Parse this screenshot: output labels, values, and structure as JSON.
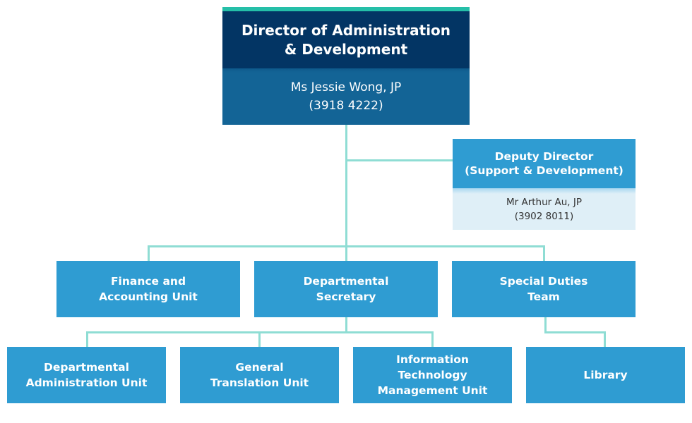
{
  "director": {
    "title_line1": "Director of Administration",
    "title_line2": "& Development",
    "name": "Ms Jessie Wong, JP",
    "phone": "(3918 4222)"
  },
  "deputy": {
    "title_line1": "Deputy Director",
    "title_line2": "(Support & Development)",
    "name": "Mr Arthur Au, JP",
    "phone": "(3902 8011)"
  },
  "units_level1": [
    {
      "label": "Finance and\nAccounting Unit"
    },
    {
      "label": "Departmental\nSecretary"
    },
    {
      "label": "Special Duties\nTeam"
    }
  ],
  "units_level2": [
    {
      "label": "Departmental\nAdministration Unit"
    },
    {
      "label": "General\nTranslation Unit"
    },
    {
      "label": "Information\nTechnology\nManagement Unit"
    },
    {
      "label": "Library"
    }
  ],
  "colors": {
    "accent": "#25bfa8",
    "director_header": "#033564",
    "director_body": "#136496",
    "unit_box": "#2f9cd2",
    "deputy_body": "#dfeff7",
    "connector": "#8fddd4"
  }
}
